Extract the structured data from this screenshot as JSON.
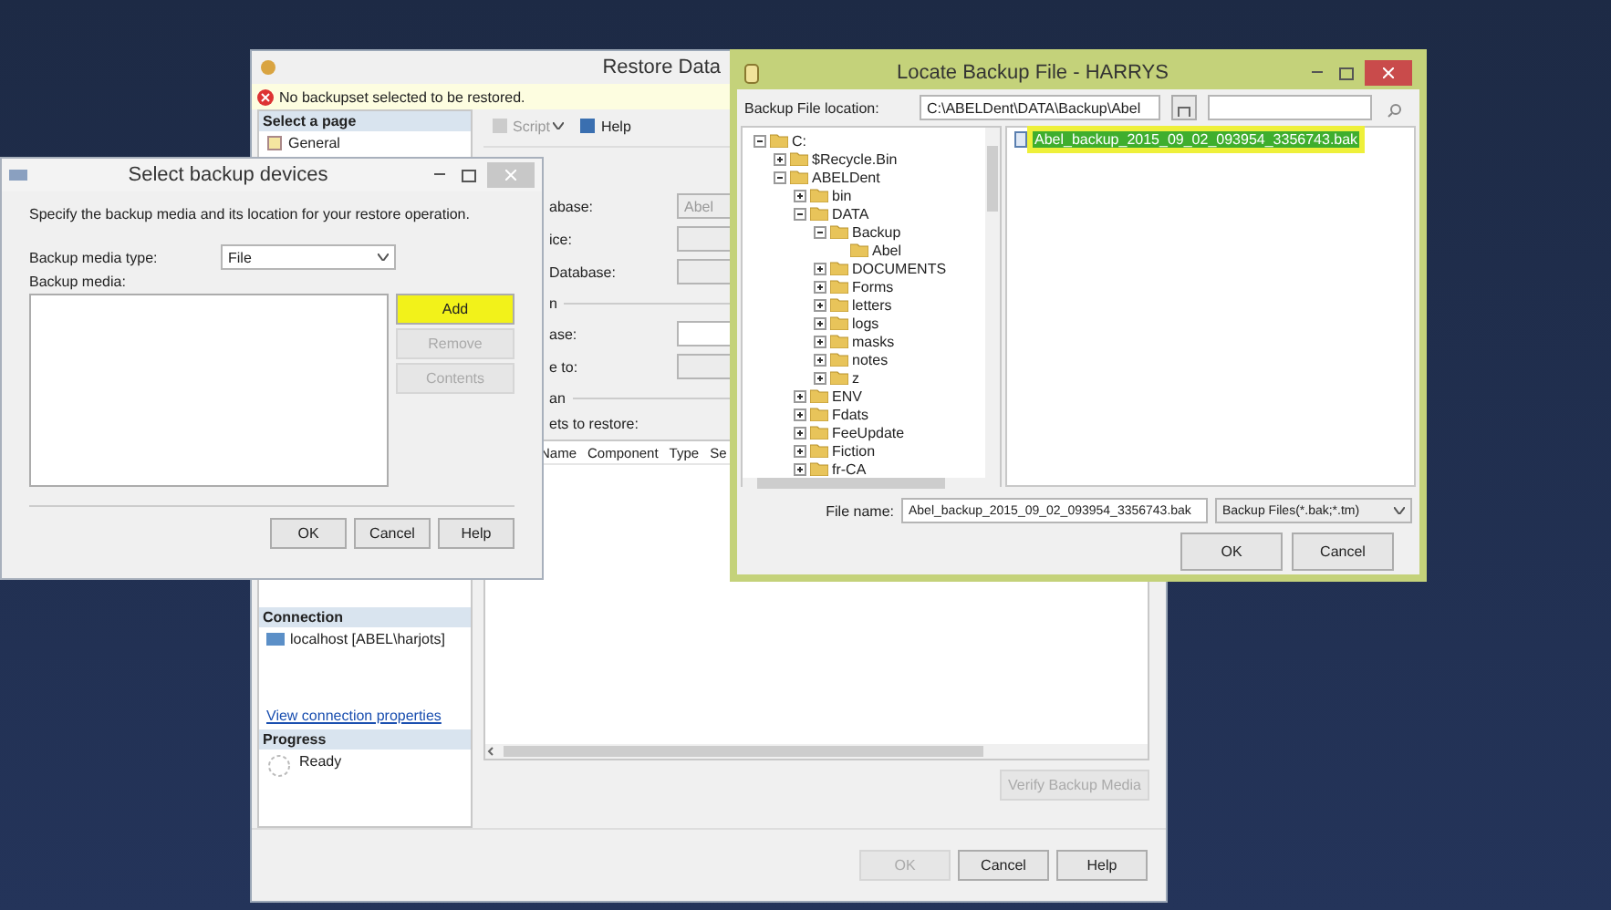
{
  "restore_window": {
    "title": "Restore Data",
    "warning": "No backupset selected to be restored.",
    "pages_header": "Select a page",
    "pages": [
      "General"
    ],
    "toolbar": [
      {
        "label": "Script",
        "kind": "dropdown"
      },
      {
        "label": "Help",
        "kind": "plain"
      }
    ],
    "rows": [
      {
        "kind": "field",
        "label": "abase:",
        "value": "Abel",
        "disabled": true
      },
      {
        "kind": "field",
        "label": "ice:",
        "disabled": true
      },
      {
        "kind": "field",
        "label": "Database:",
        "disabled": true
      },
      {
        "kind": "section",
        "label": "n"
      },
      {
        "kind": "field",
        "label": "ase:",
        "disabled": false
      },
      {
        "kind": "field",
        "label": "e to:",
        "disabled": true
      },
      {
        "kind": "section",
        "label": "an"
      },
      {
        "kind": "label",
        "label": "ets to restore:"
      }
    ],
    "grid_columns": [
      "Name",
      "Component",
      "Type",
      "Se"
    ],
    "connection_header": "Connection",
    "server": "localhost [ABEL\\harjots]",
    "connection_link": "View connection properties",
    "progress_header": "Progress",
    "progress_status": "Ready",
    "verify_button": {
      "label": "Verify Backup Media",
      "disabled": true
    },
    "buttons": [
      {
        "label": "OK",
        "disabled": true
      },
      {
        "label": "Cancel",
        "disabled": false
      },
      {
        "label": "Help",
        "disabled": false
      }
    ]
  },
  "select_dialog": {
    "title": "Select backup devices",
    "description": "Specify the backup media and its location for your restore operation.",
    "media_type_label": "Backup media type:",
    "media_type": "File",
    "media_label": "Backup media:",
    "side_buttons": [
      {
        "label": "Add",
        "disabled": false,
        "highlighted": true
      },
      {
        "label": "Remove",
        "disabled": true,
        "highlighted": false
      },
      {
        "label": "Contents",
        "disabled": true,
        "highlighted": false
      }
    ],
    "buttons": [
      "OK",
      "Cancel",
      "Help"
    ]
  },
  "locate_window": {
    "title": "Locate Backup File - HARRYS",
    "location_label": "Backup File location:",
    "location": "C:\\ABELDent\\DATA\\Backup\\Abel",
    "tree": [
      {
        "label": "C:",
        "expanded": true,
        "children": [
          {
            "label": "$Recycle.Bin",
            "expanded": false
          },
          {
            "label": "ABELDent",
            "expanded": true,
            "children": [
              {
                "label": "bin",
                "expanded": false
              },
              {
                "label": "DATA",
                "expanded": true,
                "children": [
                  {
                    "label": "Backup",
                    "expanded": true,
                    "children": [
                      {
                        "label": "Abel"
                      }
                    ]
                  },
                  {
                    "label": "DOCUMENTS",
                    "expanded": false
                  },
                  {
                    "label": "Forms",
                    "expanded": false
                  },
                  {
                    "label": "letters",
                    "expanded": false
                  },
                  {
                    "label": "logs",
                    "expanded": false
                  },
                  {
                    "label": "masks",
                    "expanded": false
                  },
                  {
                    "label": "notes",
                    "expanded": false
                  },
                  {
                    "label": "z",
                    "expanded": false
                  }
                ]
              },
              {
                "label": "ENV",
                "expanded": false
              },
              {
                "label": "Fdats",
                "expanded": false
              },
              {
                "label": "FeeUpdate",
                "expanded": false
              },
              {
                "label": "Fiction",
                "expanded": false
              },
              {
                "label": "fr-CA",
                "expanded": false
              }
            ]
          }
        ]
      }
    ],
    "files": [
      {
        "name": "Abel_backup_2015_09_02_093954_3356743.bak",
        "selected": true,
        "highlighted": true
      }
    ],
    "file_name_label": "File name:",
    "file_name": "Abel_backup_2015_09_02_093954_3356743.bak",
    "filter": "Backup Files(*.bak;*.tm)",
    "buttons": [
      "OK",
      "Cancel"
    ]
  }
}
